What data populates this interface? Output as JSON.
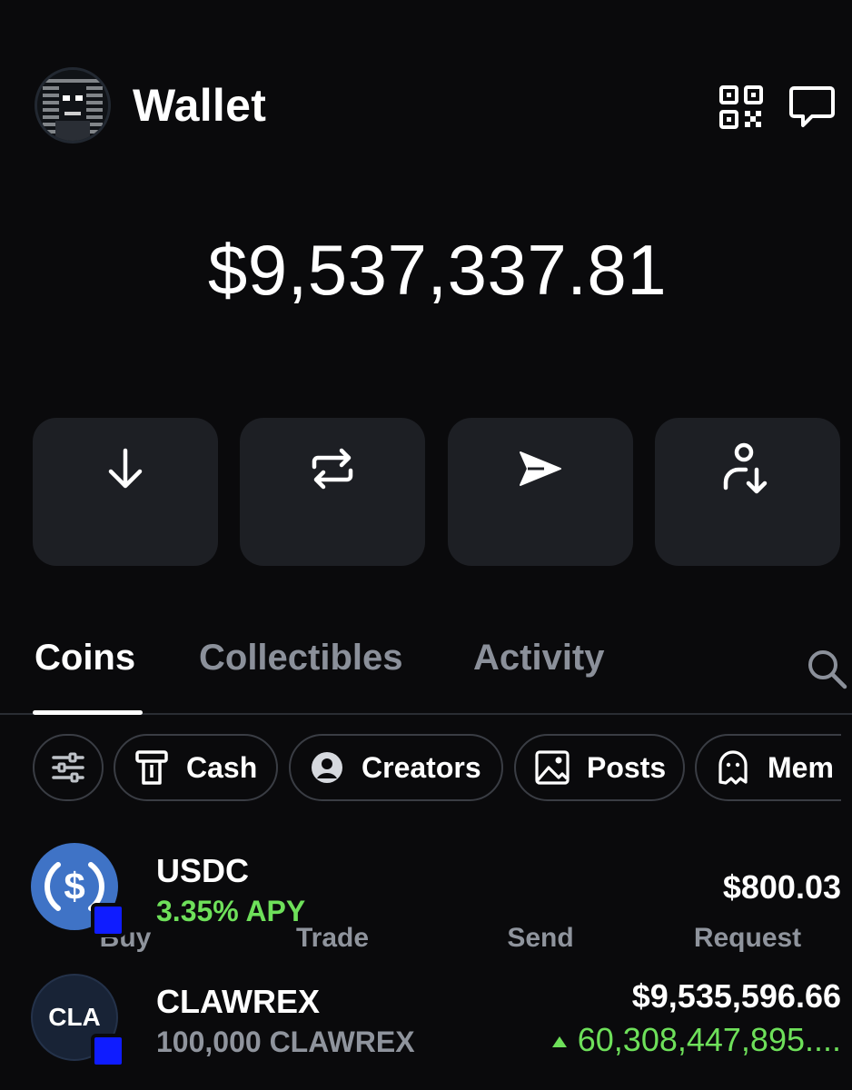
{
  "header": {
    "title": "Wallet",
    "avatar_icon": "pixel-portrait-avatar",
    "qr_icon": "qr-code-icon",
    "chat_icon": "chat-bubble-icon"
  },
  "balance": "$9,537,337.81",
  "actions": [
    {
      "label": "Buy",
      "icon": "arrow-down-icon"
    },
    {
      "label": "Trade",
      "icon": "swap-arrows-icon"
    },
    {
      "label": "Send",
      "icon": "paper-plane-icon"
    },
    {
      "label": "Request",
      "icon": "person-arrow-down-icon"
    }
  ],
  "tabs": [
    {
      "label": "Coins",
      "active": true
    },
    {
      "label": "Collectibles",
      "active": false
    },
    {
      "label": "Activity",
      "active": false
    }
  ],
  "filters": [
    {
      "label": "",
      "icon": "sliders-icon"
    },
    {
      "label": "Cash",
      "icon": "cash-icon"
    },
    {
      "label": "Creators",
      "icon": "person-circle-icon"
    },
    {
      "label": "Posts",
      "icon": "image-icon"
    },
    {
      "label": "Mem",
      "icon": "ghost-icon"
    }
  ],
  "coins": [
    {
      "name": "USDC",
      "sub": "3.35% APY",
      "value": "$800.03",
      "change": "",
      "logo_text": "$",
      "logo_color": "#3f73c6"
    },
    {
      "name": "CLAWREX",
      "sub": "100,000 CLAWREX",
      "value": "$9,535,596.66",
      "change": "60,308,447,895....",
      "change_direction": "up",
      "logo_text": "CLA",
      "logo_color": "#182336"
    }
  ],
  "colors": {
    "background": "#0a0a0c",
    "card": "#1d1f24",
    "muted_text": "#8f949d",
    "positive": "#6ee05a",
    "badge_blue": "#0f1cff"
  }
}
